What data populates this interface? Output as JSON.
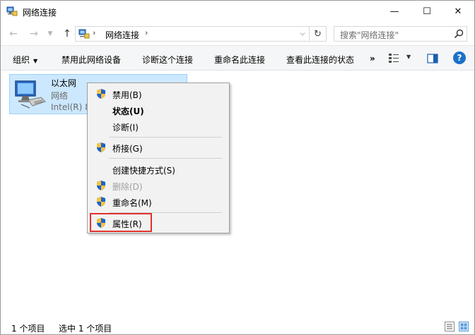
{
  "window": {
    "title": "网络连接",
    "controls": {
      "minimize": "—",
      "maximize": "☐",
      "close": "✕"
    }
  },
  "address": {
    "back": "←",
    "forward": "→",
    "history": "▼",
    "up": "↑",
    "separator": "›",
    "segment": "网络连接",
    "dropdown": "⌵",
    "refresh": "↻",
    "search_placeholder": "搜索\"网络连接\""
  },
  "toolbar": {
    "organize": "组织",
    "organize_arrow": "▼",
    "disable_device": "禁用此网络设备",
    "diagnose": "诊断这个连接",
    "rename": "重命名此连接",
    "view_status": "查看此连接的状态",
    "more": "»",
    "view_dropdown": "▼",
    "help": "?"
  },
  "connection": {
    "name": "以太网",
    "type": "网络",
    "device": "Intel(R) 8"
  },
  "context_menu": {
    "items": [
      {
        "label": "禁用(B)",
        "shield": true,
        "bold": false,
        "disabled": false
      },
      {
        "label": "状态(U)",
        "shield": false,
        "bold": true,
        "disabled": false
      },
      {
        "label": "诊断(I)",
        "shield": false,
        "bold": false,
        "disabled": false
      },
      {
        "label": "桥接(G)",
        "shield": true,
        "bold": false,
        "disabled": false
      },
      {
        "label": "创建快捷方式(S)",
        "shield": false,
        "bold": false,
        "disabled": false
      },
      {
        "label": "删除(D)",
        "shield": true,
        "bold": false,
        "disabled": true
      },
      {
        "label": "重命名(M)",
        "shield": true,
        "bold": false,
        "disabled": false
      },
      {
        "label": "属性(R)",
        "shield": true,
        "bold": false,
        "disabled": false
      }
    ],
    "highlighted_item": "属性(R)",
    "highlight_color": "#e0322e"
  },
  "status": {
    "item_count": "1 个项目",
    "selected": "选中 1 个项目"
  },
  "colors": {
    "selection_bg": "#cce8ff",
    "selection_border": "#99d1ff",
    "menu_bg": "#f2f2f2",
    "help_blue": "#1a72c9"
  }
}
